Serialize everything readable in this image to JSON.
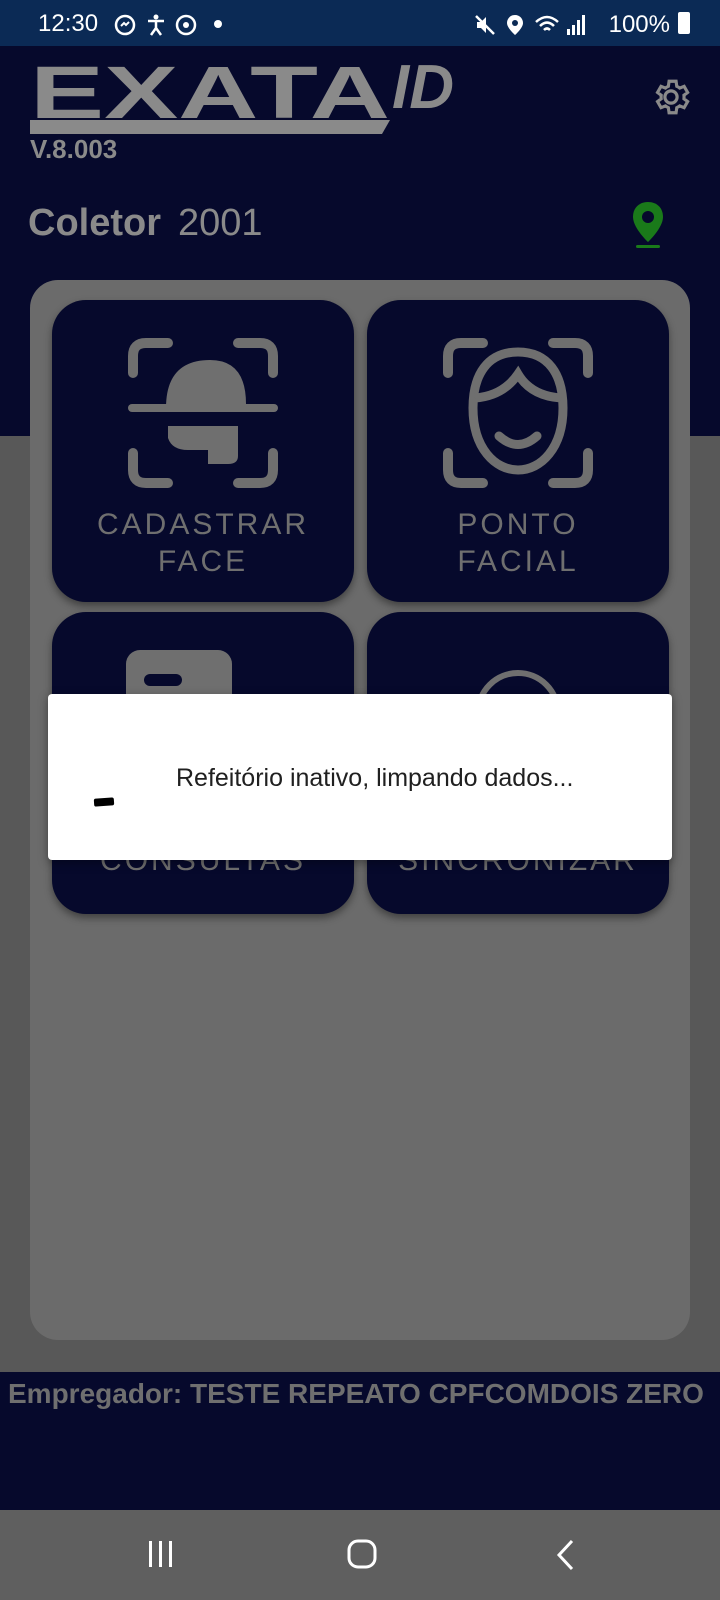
{
  "status_bar": {
    "time": "12:30",
    "battery": "100%",
    "left_icons": [
      "messenger-icon",
      "accessibility-icon",
      "sync-icon",
      "dot-icon"
    ],
    "right_icons": [
      "mute-icon",
      "location-icon",
      "wifi-icon",
      "signal-icon",
      "battery-icon"
    ]
  },
  "app": {
    "logo_text": "EXATA ID",
    "version": "V.8.003",
    "coletor_label": "Coletor",
    "coletor_value": "2001",
    "colors": {
      "header_bg": "#06092c",
      "tile_bg": "#06092c",
      "pin": "#1a7a1a"
    }
  },
  "tiles": [
    {
      "line1": "CADASTRAR",
      "line2": "FACE",
      "icon": "face-scan-icon"
    },
    {
      "line1": "PONTO",
      "line2": "FACIAL",
      "icon": "face-smile-icon"
    },
    {
      "line1": "",
      "line2": "CONSULTAS",
      "icon": "id-card-icon"
    },
    {
      "line1": "",
      "line2": "SINCRONIZAR",
      "icon": "sync-circle-icon"
    }
  ],
  "footer": {
    "employer": "Empregador: TESTE REPEATO CPFCOMDOIS ZERO"
  },
  "dialog": {
    "message": "Refeitório inativo, limpando dados..."
  },
  "nav": [
    "recents-icon",
    "home-icon",
    "back-icon"
  ]
}
